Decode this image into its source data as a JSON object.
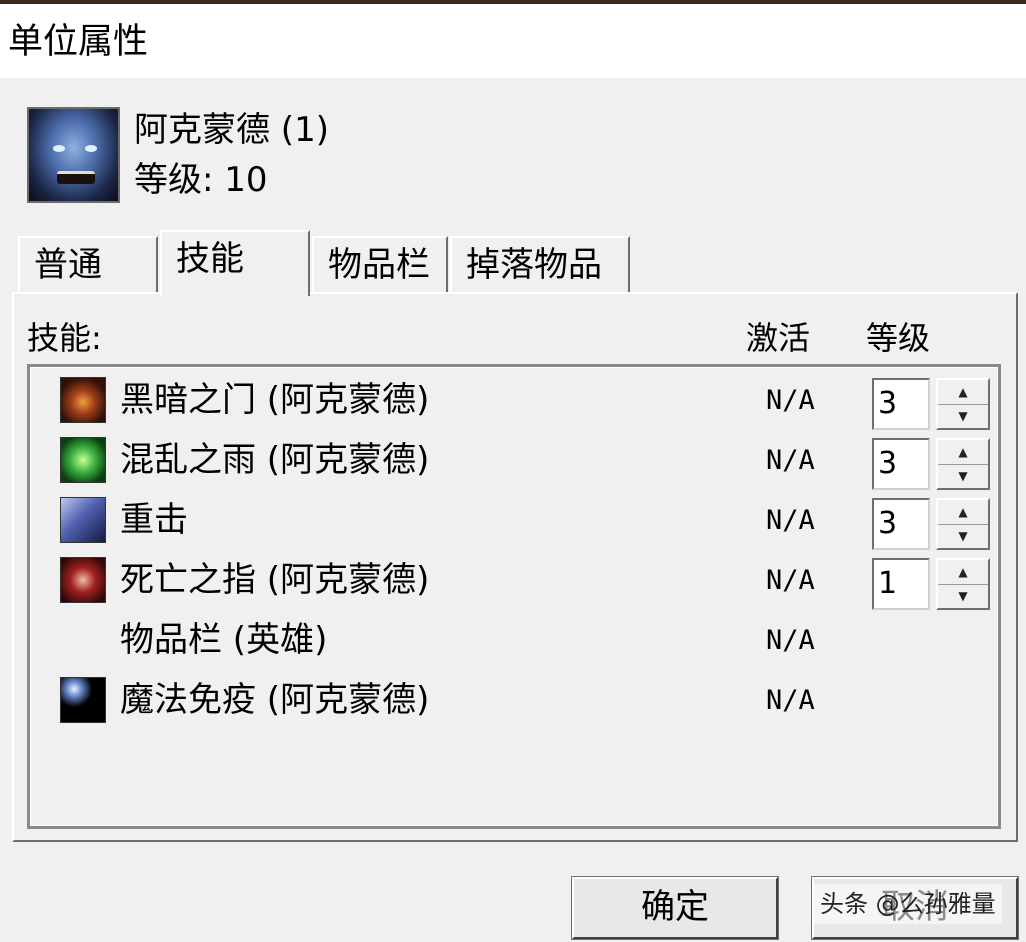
{
  "window": {
    "title": "单位属性"
  },
  "unit": {
    "name": "阿克蒙德 (1)",
    "level": "等级: 10"
  },
  "tabs": [
    {
      "label": "普通",
      "active": false
    },
    {
      "label": "技能",
      "active": true
    },
    {
      "label": "物品栏",
      "active": false
    },
    {
      "label": "掉落物品",
      "active": false
    }
  ],
  "skills_panel": {
    "header_skill": "技能:",
    "header_active": "激活",
    "header_level": "等级",
    "rows": [
      {
        "name": "黑暗之门 (阿克蒙德)",
        "active": "N/A",
        "level": "3",
        "icon": "dark-portal-icon"
      },
      {
        "name": "混乱之雨 (阿克蒙德)",
        "active": "N/A",
        "level": "3",
        "icon": "rain-of-chaos-icon"
      },
      {
        "name": "重击",
        "active": "N/A",
        "level": "3",
        "icon": "bash-icon"
      },
      {
        "name": "死亡之指 (阿克蒙德)",
        "active": "N/A",
        "level": "1",
        "icon": "finger-of-death-icon"
      },
      {
        "name": "物品栏 (英雄)",
        "active": "N/A"
      },
      {
        "name": "魔法免疫 (阿克蒙德)",
        "active": "N/A",
        "icon": "spell-immunity-icon"
      }
    ]
  },
  "buttons": {
    "ok": "确定",
    "cancel": "取消"
  },
  "watermark": "头条 @么孙雅量"
}
